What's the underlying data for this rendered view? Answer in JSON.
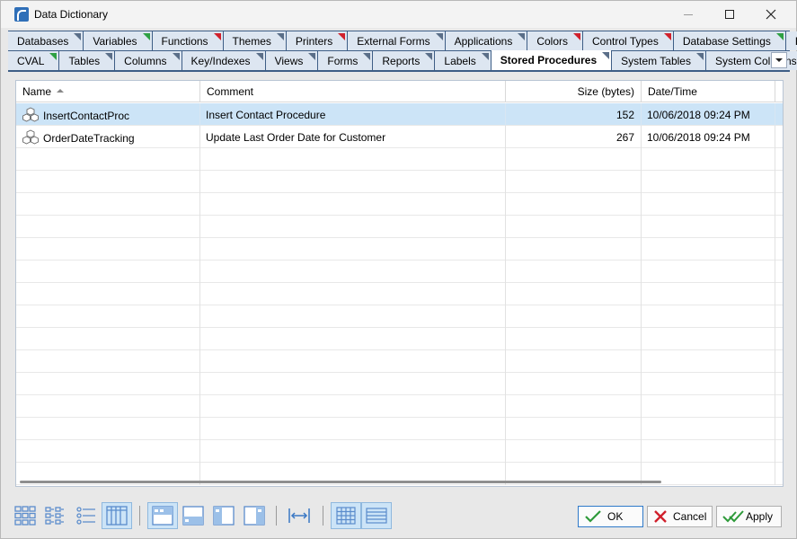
{
  "window": {
    "title": "Data Dictionary",
    "icon": "data-dictionary-app-icon"
  },
  "tabs": {
    "row1": [
      {
        "label": "Databases",
        "marker": "blue"
      },
      {
        "label": "Variables",
        "marker": "green"
      },
      {
        "label": "Functions",
        "marker": "red"
      },
      {
        "label": "Themes",
        "marker": "blue"
      },
      {
        "label": "Printers",
        "marker": "red"
      },
      {
        "label": "External Forms",
        "marker": "blue"
      },
      {
        "label": "Applications",
        "marker": "blue"
      },
      {
        "label": "Colors",
        "marker": "red"
      },
      {
        "label": "Control Types",
        "marker": "red"
      },
      {
        "label": "Database Settings",
        "marker": "green"
      },
      {
        "label": "Files",
        "marker": "blue"
      }
    ],
    "row2": [
      {
        "label": "CVAL",
        "marker": "green"
      },
      {
        "label": "Tables",
        "marker": "blue"
      },
      {
        "label": "Columns",
        "marker": "blue"
      },
      {
        "label": "Key/Indexes",
        "marker": "blue"
      },
      {
        "label": "Views",
        "marker": "blue"
      },
      {
        "label": "Forms",
        "marker": "blue"
      },
      {
        "label": "Reports",
        "marker": "blue"
      },
      {
        "label": "Labels",
        "marker": "blue"
      },
      {
        "label": "Stored Procedures",
        "marker": "blue",
        "active": true
      },
      {
        "label": "System Tables",
        "marker": "blue"
      },
      {
        "label": "System Columns",
        "marker": "blue"
      }
    ]
  },
  "grid": {
    "columns": [
      {
        "label": "Name",
        "sort": "ascending"
      },
      {
        "label": "Comment"
      },
      {
        "label": "Size (bytes)"
      },
      {
        "label": "Date/Time"
      }
    ],
    "rows": [
      {
        "name": "InsertContactProc",
        "comment": "Insert Contact Procedure",
        "size": "152",
        "datetime": "10/06/2018 09:24 PM",
        "selected": true
      },
      {
        "name": "OrderDateTracking",
        "comment": "Update Last Order Date for Customer",
        "size": "267",
        "datetime": "10/06/2018 09:24 PM",
        "selected": false
      }
    ],
    "empty_rows": 15
  },
  "buttons": {
    "ok": "OK",
    "cancel": "Cancel",
    "apply": "Apply"
  },
  "colors": {
    "tab_strip": "#3e5e86",
    "selected_row": "#cce4f7",
    "marker_green": "#2ea043",
    "marker_red": "#d0202c"
  }
}
